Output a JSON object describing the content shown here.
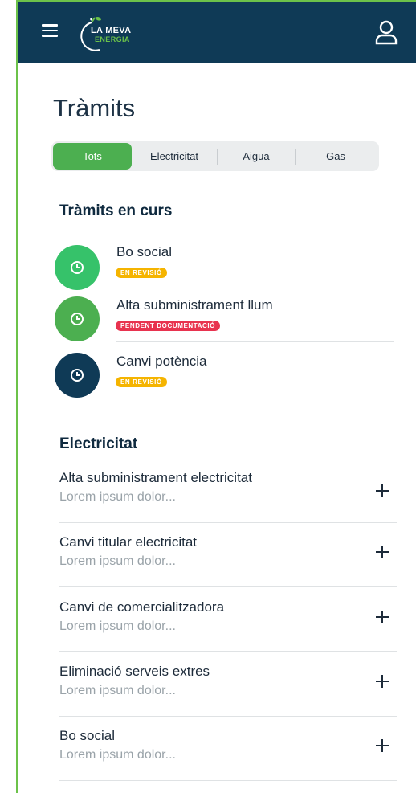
{
  "header": {
    "logo_line1": "LA MEVA",
    "logo_line2": "ENERGIA",
    "menu_icon": "hamburger-icon",
    "user_icon": "user-icon"
  },
  "page": {
    "title": "Tràmits"
  },
  "filters": {
    "tabs": [
      "Tots",
      "Electricitat",
      "Aigua",
      "Gas"
    ],
    "selected": "Tots"
  },
  "in_progress": {
    "title": "Tràmits en curs",
    "items": [
      {
        "name": "Bo social",
        "status": "EN REVISIÓ",
        "icon": "clock-icon",
        "color": "#36c26a"
      },
      {
        "name": "Alta subministrament llum",
        "status": "PENDENT DOCUMENTACIÓ",
        "icon": "clock-icon",
        "color": "#4caf50"
      },
      {
        "name": "Canvi potència",
        "status": "EN REVISIÓ",
        "icon": "clock-icon",
        "color": "#0f3a56"
      }
    ]
  },
  "electricity": {
    "title": "Electricitat",
    "items": [
      {
        "title": "Alta subministrament electricitat",
        "subtitle": "Lorem ipsum dolor..."
      },
      {
        "title": "Canvi titular electricitat",
        "subtitle": "Lorem ipsum dolor..."
      },
      {
        "title": "Canvi de comercialitzadora",
        "subtitle": "Lorem ipsum dolor..."
      },
      {
        "title": "Eliminació serveis extres",
        "subtitle": "Lorem ipsum dolor..."
      },
      {
        "title": "Bo social",
        "subtitle": "Lorem ipsum dolor..."
      }
    ]
  },
  "colors": {
    "header_bg": "#0f3a56",
    "accent_green": "#4caf50",
    "badge_review": "#f5b400",
    "badge_pending": "#e8334f"
  }
}
